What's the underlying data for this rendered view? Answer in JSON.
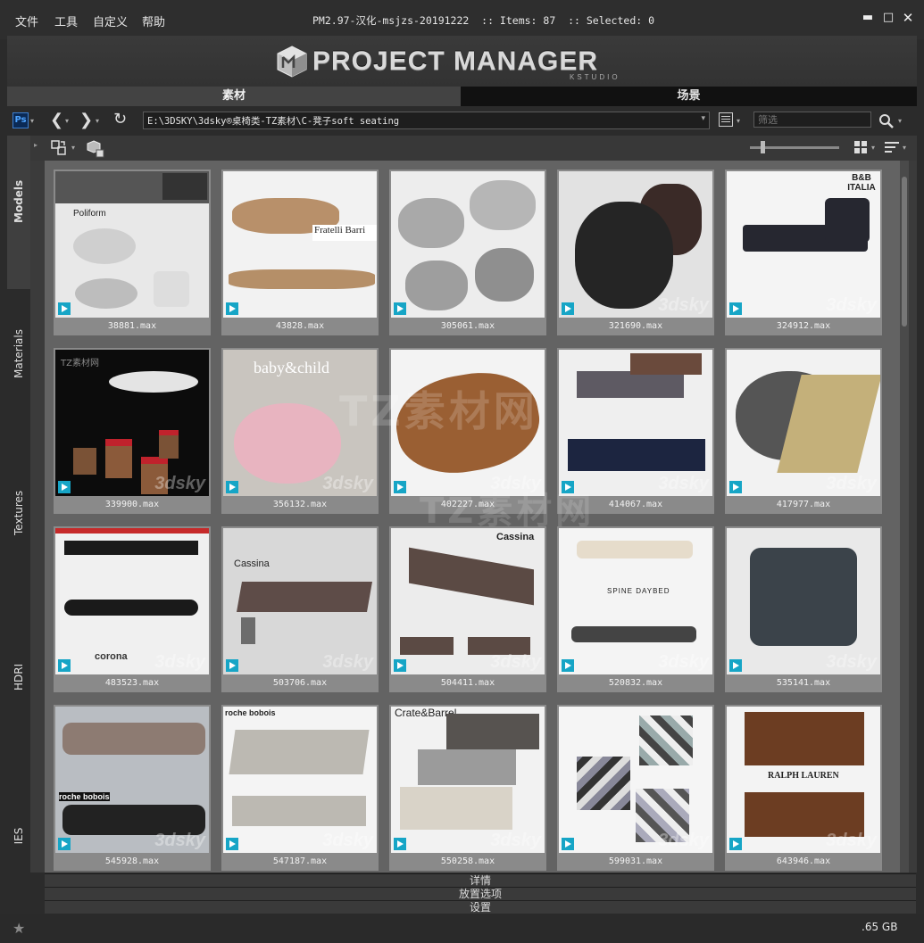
{
  "menu": {
    "file": "文件",
    "tools": "工具",
    "custom": "自定义",
    "help": "帮助"
  },
  "window": {
    "title": "PM2.97-汉化-msjzs-20191222  :: Items: 87  :: Selected: 0"
  },
  "banner": {
    "logo": "PROJECT MANAGER",
    "sub": "KSTUDIO"
  },
  "tabs": {
    "assets": "素材",
    "scene": "场景"
  },
  "toolbar": {
    "path": "E:\\3DSKY\\3dsky®桌椅类-TZ素材\\C-凳子soft seating",
    "filter_placeholder": "筛选",
    "ps_label": "Ps"
  },
  "side_tabs": [
    "Models",
    "Materials",
    "Textures",
    "HDRI",
    "IES"
  ],
  "items": [
    {
      "label": "38881.max",
      "brand": "Poliform",
      "bg": "#e8e8e8"
    },
    {
      "label": "43828.max",
      "brand": "Fratelli Barri",
      "bg": "#f2f2f2"
    },
    {
      "label": "305061.max",
      "brand": "",
      "bg": "#ededed"
    },
    {
      "label": "321690.max",
      "brand": "",
      "bg": "#e2e2e2"
    },
    {
      "label": "324912.max",
      "brand": "B&B ITALIA",
      "bg": "#f4f4f4"
    },
    {
      "label": "339900.max",
      "brand": "TZ素材网",
      "bg": "#0c0c0c"
    },
    {
      "label": "356132.max",
      "brand": "baby&child",
      "bg": "#c9c5bf"
    },
    {
      "label": "402227.max",
      "brand": "",
      "bg": "#f3f3f3"
    },
    {
      "label": "414067.max",
      "brand": "",
      "bg": "#efefef"
    },
    {
      "label": "417977.max",
      "brand": "",
      "bg": "#f2f2f2"
    },
    {
      "label": "483523.max",
      "brand": "corona",
      "bg": "#f0f0f0"
    },
    {
      "label": "503706.max",
      "brand": "Cassina",
      "bg": "#d8d8d8"
    },
    {
      "label": "504411.max",
      "brand": "Cassina",
      "bg": "#ececec"
    },
    {
      "label": "520832.max",
      "brand": "SPINE DAYBED",
      "bg": "#f4f4f4"
    },
    {
      "label": "535141.max",
      "brand": "",
      "bg": "#e9e9e9"
    },
    {
      "label": "545928.max",
      "brand": "roche bobois",
      "bg": "#b9bdc2"
    },
    {
      "label": "547187.max",
      "brand": "roche bobois",
      "bg": "#f4f4f4"
    },
    {
      "label": "550258.max",
      "brand": "Crate&Barrel",
      "bg": "#f2f2f2"
    },
    {
      "label": "599031.max",
      "brand": "",
      "bg": "#f5f5f5"
    },
    {
      "label": "643946.max",
      "brand": "RALPH LAUREN",
      "bg": "#f3f3f3"
    }
  ],
  "bottom_panels": {
    "details": "详情",
    "placement": "放置选项",
    "settings": "设置"
  },
  "status": {
    "disk": ".65 GB"
  },
  "watermarks": {
    "main": "TZ素材网",
    "secondary": "TZ素材网"
  }
}
